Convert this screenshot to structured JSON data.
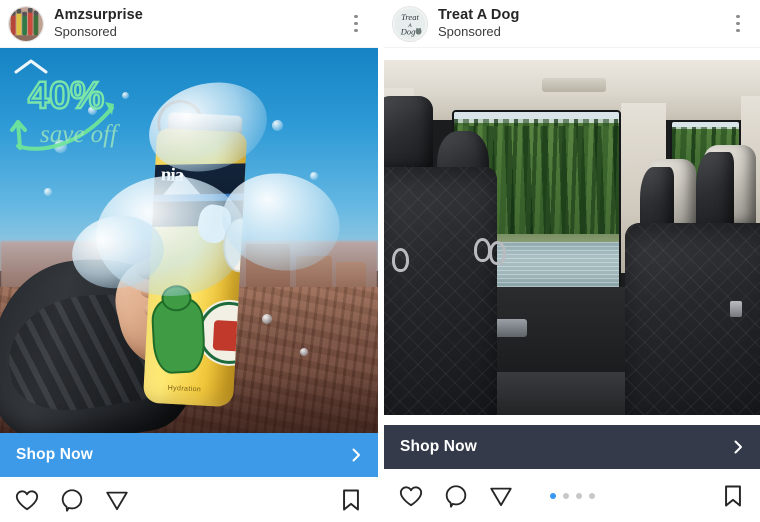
{
  "posts": [
    {
      "id": "amzsurprise",
      "account_name": "Amzsurprise",
      "subtitle": "Sponsored",
      "avatar_alt": "amzsurprise-avatar",
      "menu_icon": "more-options-icon",
      "media_alt": "yellow-water-bottle-with-stickers-held-over-canyon",
      "overlay": {
        "discount": "40%",
        "caption": "save off",
        "color": "#7ee8a0"
      },
      "cta": {
        "label": "Shop Now",
        "chevron_icon": "chevron-right-icon",
        "background": "#3c9ae8",
        "text_color": "#ffffff"
      },
      "actions": {
        "like_icon": "heart-icon",
        "comment_icon": "comment-icon",
        "share_icon": "send-icon",
        "save_icon": "bookmark-icon"
      },
      "carousel": null
    },
    {
      "id": "treat-a-dog",
      "account_name": "Treat A Dog",
      "subtitle": "Sponsored",
      "avatar_alt": "treat-a-dog-avatar",
      "avatar_text_line1": "Treat",
      "avatar_text_line2": "A",
      "avatar_text_line3": "Dog",
      "menu_icon": "more-options-icon",
      "media_alt": "suv-rear-bench-with-black-quilted-dog-seat-cover-forest-lake-through-window",
      "cta": {
        "label": "Shop Now",
        "chevron_icon": "chevron-right-icon",
        "background": "#343a49",
        "text_color": "#ffffff"
      },
      "actions": {
        "like_icon": "heart-icon",
        "comment_icon": "comment-icon",
        "share_icon": "send-icon",
        "save_icon": "bookmark-icon"
      },
      "carousel": {
        "total": 4,
        "active_index": 0,
        "active_color": "#3897f0",
        "inactive_color": "#c7c7c7"
      }
    }
  ]
}
